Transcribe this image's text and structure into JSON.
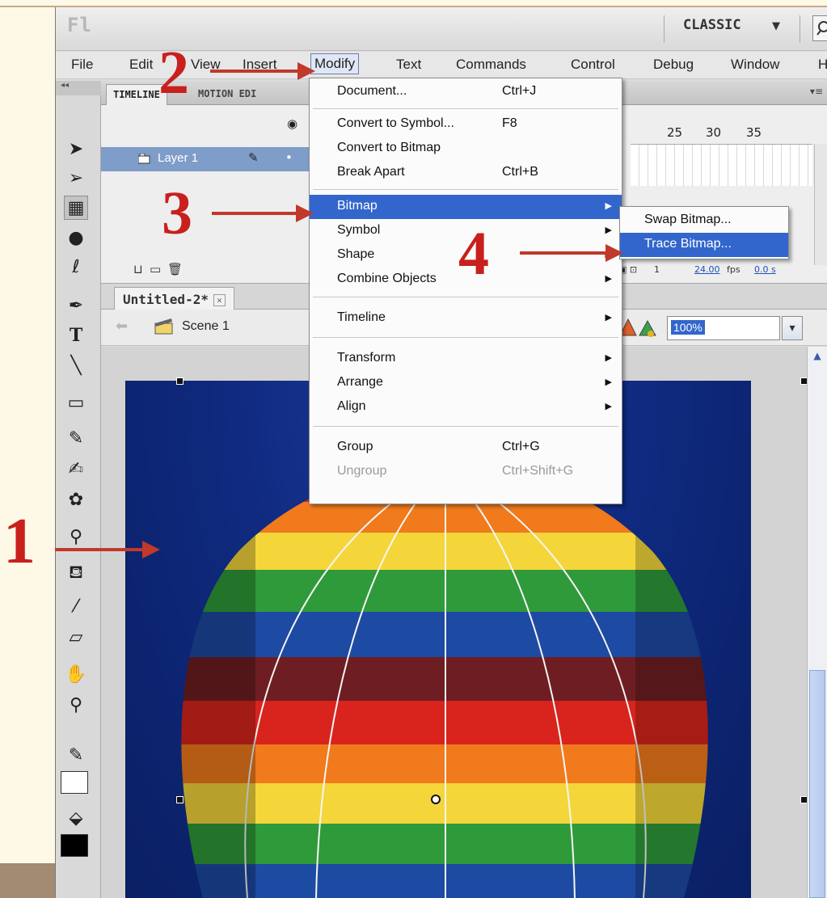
{
  "app": {
    "logo": "Fl",
    "workspace": "CLASSIC",
    "workspace_arrow": "▼"
  },
  "menubar": [
    "File",
    "Edit",
    "View",
    "Insert",
    "Modify",
    "Text",
    "Commands",
    "Control",
    "Debug",
    "Window",
    "H"
  ],
  "panel": {
    "tabs": [
      "TIMELINE",
      "MOTION EDI"
    ],
    "frame_numbers": [
      "25",
      "30",
      "35"
    ],
    "layer_name": "Layer 1",
    "frame_current": "1",
    "fps": "24.00",
    "fps_unit": "fps",
    "time": "0.0 s"
  },
  "document": {
    "tab_title": "Untitled-2*",
    "tab_close": "✕",
    "scene_label": "Scene 1",
    "zoom": "100%"
  },
  "modify_menu": {
    "items": [
      {
        "label": "Document...",
        "shortcut": "Ctrl+J"
      },
      {
        "label": "Convert to Symbol...",
        "shortcut": "F8"
      },
      {
        "label": "Convert to Bitmap",
        "shortcut": ""
      },
      {
        "label": "Break Apart",
        "shortcut": "Ctrl+B"
      },
      {
        "label": "Bitmap",
        "shortcut": ""
      },
      {
        "label": "Symbol",
        "shortcut": ""
      },
      {
        "label": "Shape",
        "shortcut": ""
      },
      {
        "label": "Combine Objects",
        "shortcut": ""
      },
      {
        "label": "Timeline",
        "shortcut": ""
      },
      {
        "label": "Transform",
        "shortcut": ""
      },
      {
        "label": "Arrange",
        "shortcut": ""
      },
      {
        "label": "Align",
        "shortcut": ""
      },
      {
        "label": "Group",
        "shortcut": "Ctrl+G"
      },
      {
        "label": "Ungroup",
        "shortcut": "Ctrl+Shift+G"
      }
    ],
    "highlighted": "Bitmap",
    "disabled": "Ungroup"
  },
  "bitmap_submenu": {
    "items": [
      "Swap Bitmap...",
      "Trace Bitmap..."
    ],
    "highlighted": "Trace Bitmap..."
  },
  "steps": [
    "1",
    "2",
    "3",
    "4"
  ],
  "colors": {
    "highlight": "#3366cc",
    "annotation": "#c8201d",
    "layer_selected": "#7f9dc9",
    "slide_background": "#fdf9e6"
  },
  "icons": {
    "tools": [
      "selection-icon",
      "subselection-icon",
      "free-transform-icon",
      "3d-rotation-icon",
      "lasso-icon",
      "pen-icon",
      "text-icon",
      "line-icon",
      "rectangle-icon",
      "pencil-icon",
      "brush-icon",
      "deco-icon",
      "bone-icon",
      "paint-bucket-icon",
      "eyedropper-icon",
      "eraser-icon",
      "hand-icon",
      "zoom-icon",
      "stroke-color-icon",
      "fill-color-icon"
    ]
  }
}
